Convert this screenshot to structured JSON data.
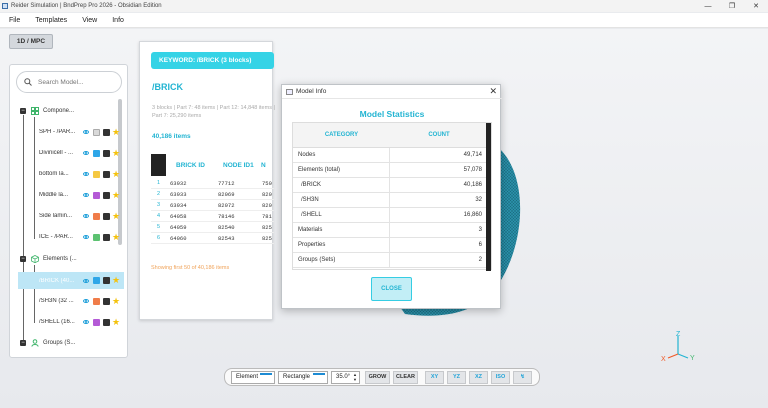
{
  "window": {
    "title": "Reider Simulation | BndPrep Pro 2026 - Obsidian Edition",
    "minimize": "—",
    "maximize": "❐",
    "close": "✕"
  },
  "menu": [
    "File",
    "Templates",
    "View",
    "Info"
  ],
  "mode_button": "1D / MPC",
  "search": {
    "placeholder": "Search Model..."
  },
  "tree": {
    "components": {
      "label": "Compone...",
      "items": [
        {
          "label": "SPH - /PAR...",
          "color": "#d9d9d9"
        },
        {
          "label": "Divinicell - ...",
          "color": "#2ea6e8"
        },
        {
          "label": "bottom la...",
          "color": "#f5c842"
        },
        {
          "label": "Middle la...",
          "color": "#b45ad6"
        },
        {
          "label": "Side lamin...",
          "color": "#f07c49"
        },
        {
          "label": "ICE - /PAR...",
          "color": "#5cc271"
        }
      ]
    },
    "elements": {
      "label": "Elements (...",
      "items": [
        {
          "label": "/BRICK (40...",
          "color": "#2ea6e8",
          "selected": true
        },
        {
          "label": "/SH3N (32 ...",
          "color": "#f07c49"
        },
        {
          "label": "/SHELL (16...",
          "color": "#b45ad6"
        }
      ]
    },
    "groups": {
      "label": "Groups (S..."
    }
  },
  "panel": {
    "keyword_bar": "KEYWORD: /BRICK (3 blocks)",
    "heading": "/BRICK",
    "info_line1": "3 blocks | Part 7: 48 items | Part 12: 14,848 items |",
    "info_line2": "Part 7: 25,290 items",
    "items_count": "40,186 items",
    "columns": [
      "BRICK ID",
      "NODE ID1",
      "N"
    ],
    "rows": [
      {
        "index": "1",
        "brick_id": "63932",
        "node_id1": "77712",
        "n": "750"
      },
      {
        "index": "2",
        "brick_id": "63933",
        "node_id1": "82069",
        "n": "820"
      },
      {
        "index": "3",
        "brick_id": "63934",
        "node_id1": "82072",
        "n": "820"
      },
      {
        "index": "4",
        "brick_id": "64058",
        "node_id1": "78146",
        "n": "781"
      },
      {
        "index": "5",
        "brick_id": "64059",
        "node_id1": "82540",
        "n": "825"
      },
      {
        "index": "6",
        "brick_id": "64060",
        "node_id1": "82543",
        "n": "825"
      }
    ],
    "showing": "Showing first 50 of 40,186 items"
  },
  "dialog": {
    "title": "Model Info",
    "heading": "Model Statistics",
    "columns": [
      "CATEGORY",
      "COUNT"
    ],
    "rows": [
      {
        "category": "Nodes",
        "count": "49,714"
      },
      {
        "category": "Elements (total)",
        "count": "57,078"
      },
      {
        "category": "/BRICK",
        "count": "40,186"
      },
      {
        "category": "/SH3N",
        "count": "32"
      },
      {
        "category": "/SHELL",
        "count": "16,860"
      },
      {
        "category": "Materials",
        "count": "3"
      },
      {
        "category": "Properties",
        "count": "6"
      },
      {
        "category": "Groups (Sets)",
        "count": "2"
      }
    ],
    "close_label": "CLOSE"
  },
  "toolbar": {
    "select_type": "Element",
    "select_shape": "Rectangle",
    "angle": "35.0°",
    "grow": "GROW",
    "clear": "CLEAR",
    "views": [
      "XY",
      "YZ",
      "XZ",
      "ISO",
      "↯"
    ]
  },
  "axes": {
    "x": "X",
    "y": "Y",
    "z": "Z"
  },
  "colors": {
    "accent": "#22b4d2",
    "keyword_bar": "#35d3e6",
    "mesh": "#2a8fa8"
  }
}
